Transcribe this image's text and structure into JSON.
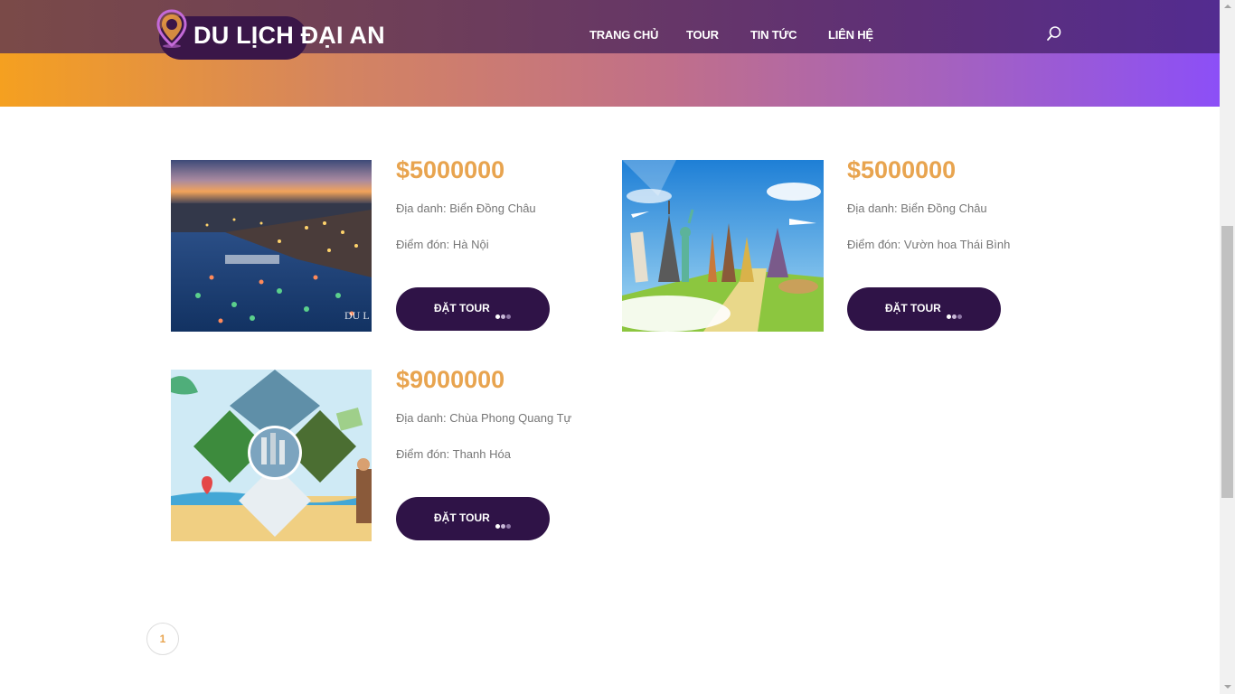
{
  "brand": {
    "name": "DU LỊCH ĐẠI AN"
  },
  "nav": {
    "items": [
      {
        "label": "TRANG CHỦ"
      },
      {
        "label": "TOUR"
      },
      {
        "label": "TIN TỨC"
      },
      {
        "label": "LIÊN HỆ"
      }
    ],
    "search_icon": "search-icon"
  },
  "colors": {
    "accent_price": "#e8a44f",
    "button_bg": "#2f1347",
    "header_gradient_start": "#f5a020",
    "header_gradient_end": "#8c4ff7"
  },
  "tours": [
    {
      "price": "$5000000",
      "place": "Địa danh: Biển Đồng Châu",
      "pickup": "Điểm đón: Hà Nội",
      "button_label": "ĐẶT TOUR",
      "image_icon": "night-river-town-photo",
      "watermark": "DU L"
    },
    {
      "price": "$5000000",
      "place": "Địa danh: Biển Đồng Châu",
      "pickup": "Điểm đón: Vườn hoa Thái Bình",
      "button_label": "ĐẶT TOUR",
      "image_icon": "world-landmarks-photo"
    },
    {
      "price": "$9000000",
      "place": "Địa danh: Chùa Phong Quang Tự",
      "pickup": "Điểm đón: Thanh Hóa",
      "button_label": "ĐẶT TOUR",
      "image_icon": "travel-collage-photo"
    }
  ],
  "pagination": {
    "current": "1"
  }
}
